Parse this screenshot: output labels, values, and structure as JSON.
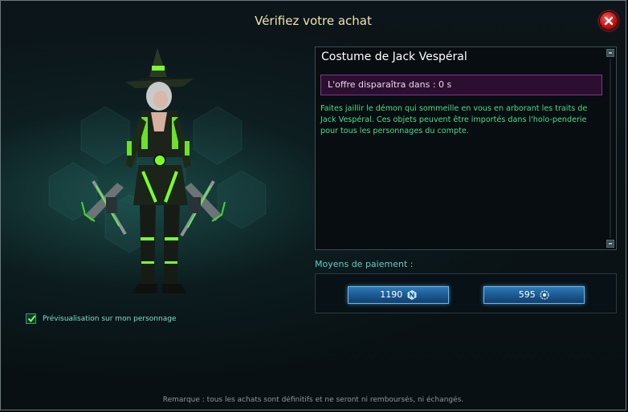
{
  "dialog": {
    "title": "Vérifiez votre achat"
  },
  "preview": {
    "checkbox_checked": true,
    "label": "Prévisualisation sur mon personnage"
  },
  "item": {
    "name": "Costume de Jack Vespéral",
    "timer": "L'offre disparaîtra dans : 0 s",
    "description": "Faites jaillir le démon qui sommeille en vous en arborant les traits de Jack Vespéral. Ces objets peuvent être importés dans l'holo-penderie pour tous les personnages du compte."
  },
  "payment": {
    "label": "Moyens de paiement :",
    "options": [
      {
        "amount": "1190",
        "currency_icon": "ncoin-icon"
      },
      {
        "amount": "595",
        "currency_icon": "omnibit-icon"
      }
    ]
  },
  "footer": {
    "note": "Remarque : tous les achats sont définitifs et ne seront ni remboursés, ni échangés."
  },
  "colors": {
    "title": "#f1e4b2",
    "description": "#46e08a",
    "timer_bg": "#2c0f30",
    "button_blue": "#1c5a92",
    "close_red": "#c01010"
  }
}
